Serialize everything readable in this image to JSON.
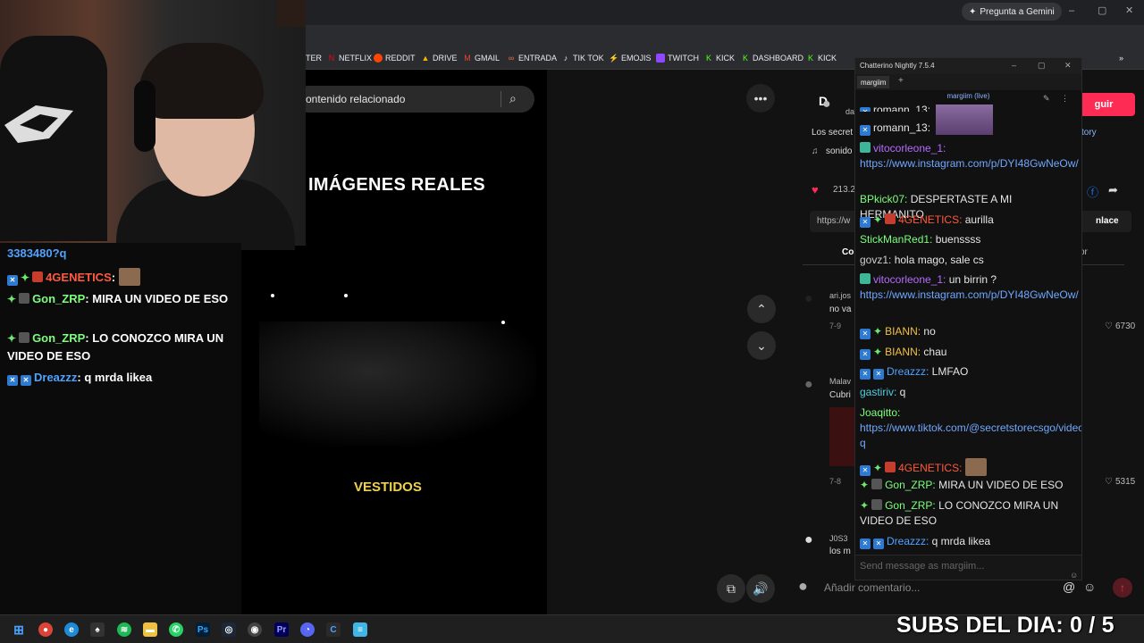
{
  "browser": {
    "gemini_label": "Pregunta a Gemini",
    "bookmarks": [
      "TER",
      "NETFLIX",
      "REDDIT",
      "DRIVE",
      "GMAIL",
      "ENTRADA",
      "TIK TOK",
      "EMOJIS",
      "TWITCH",
      "KICK",
      "DASHBOARD",
      "KICK"
    ],
    "more_icon": "chevron-double-right-icon"
  },
  "tiktok": {
    "search_placeholder": "ontenido relacionado",
    "video_title": "IMÁGENES REALES",
    "video_caption": "VESTIDOS",
    "follow_label": "guir",
    "caption_line": "Los secret",
    "sound_label": "sonido",
    "story_label": "tory",
    "likes": "213.2",
    "link_label": "https://w",
    "copy_link": "nlace",
    "comments_tab": "Co",
    "creator_tab": "or",
    "comment1_user": "ari.jos",
    "comment1_text": "no va",
    "comment1_date": "7-9",
    "comment1_likes": "6730",
    "comment2_user": "Malav",
    "comment2_text": "Cubri",
    "comment2_date": "7-8",
    "comment2_likes": "5315",
    "comment3_user": "J0S3",
    "comment3_text": "los m",
    "comment_placeholder": "Añadir comentario...",
    "header_initial": "D",
    "header_sub": "da"
  },
  "overlay_chat": [
    {
      "text": "3383480?q"
    },
    {
      "user": "4GENETICS",
      "text": ":"
    },
    {
      "user": "Gon_ZRP",
      "text": ": MIRA UN VIDEO DE ESO"
    },
    {
      "user": "Gon_ZRP",
      "text": ": LO CONOZCO MIRA UN VIDEO DE ESO"
    },
    {
      "user": "Dreazzz",
      "text": ": q mrda likea"
    }
  ],
  "chatterino": {
    "title": "Chatterino Nightly 7.5.4",
    "tab": "margiim",
    "live_label": "margiim (live)",
    "input_placeholder": "Send message as margiim...",
    "messages": [
      {
        "user": "romann_13:",
        "text": "",
        "color": "#d8d8d8"
      },
      {
        "user": "vitocorleone_1:",
        "text": "",
        "link": "https://www.instagram.com/p/DYI48GwNeOw/",
        "color": "#b36cff"
      },
      {
        "user": "BPkick07:",
        "text": " DESPERTASTE A MI HERMANITO",
        "color": "#7cff7c"
      },
      {
        "user": "4GENETICS:",
        "text": " aurilla",
        "color": "#ff5a3c"
      },
      {
        "user": "StickManRed1:",
        "text": " buenssss",
        "color": "#7cff7c"
      },
      {
        "user": "govz1:",
        "text": " hola mago, sale cs",
        "color": "#cfcfcf"
      },
      {
        "user": "vitocorleone_1:",
        "text": " un birrin ?",
        "link": "https://www.instagram.com/p/DYI48GwNeOw/",
        "color": "#b36cff"
      },
      {
        "user": "BIANN:",
        "text": " no",
        "color": "#f0c040"
      },
      {
        "user": "BIANN:",
        "text": " chau",
        "color": "#f0c040"
      },
      {
        "user": "Dreazzz:",
        "text": " LMFAO",
        "color": "#4fa3ff"
      },
      {
        "user": "gastiriv:",
        "text": " q",
        "color": "#4fd0e0"
      },
      {
        "user": "Joaqitto:",
        "text": "",
        "link": "https://www.tiktok.com/@secretstorecsgo/video/7544135444133383480?q",
        "color": "#7cff7c"
      },
      {
        "user": "4GENETICS:",
        "text": "",
        "color": "#ff5a3c"
      },
      {
        "user": "Gon_ZRP:",
        "text": " MIRA UN VIDEO DE ESO",
        "color": "#7cff7c"
      },
      {
        "user": "Gon_ZRP:",
        "text": " LO CONOZCO MIRA UN VIDEO DE ESO",
        "color": "#7cff7c"
      },
      {
        "user": "Dreazzz:",
        "text": " q mrda likea",
        "color": "#4fa3ff"
      }
    ]
  },
  "subs_overlay": "SUBS DEL DIA: 0 / 5"
}
